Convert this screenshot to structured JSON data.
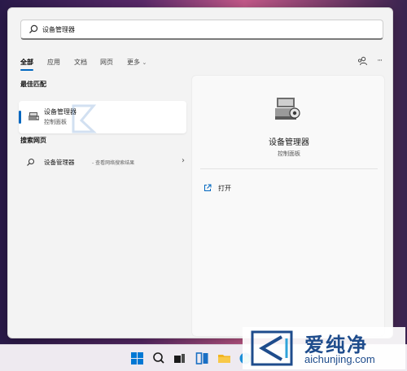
{
  "search": {
    "value": "设备管理器"
  },
  "filters": {
    "tabs": [
      {
        "label": "全部",
        "active": true
      },
      {
        "label": "应用"
      },
      {
        "label": "文档"
      },
      {
        "label": "网页"
      },
      {
        "label": "更多"
      }
    ],
    "more_chevron": "⌄",
    "ellipsis": "···",
    "share_icon": "people-icon"
  },
  "best_match": {
    "header": "最佳匹配",
    "item": {
      "title": "设备管理器",
      "subtitle": "控制面板",
      "icon": "device-manager-icon"
    }
  },
  "web_search": {
    "header": "搜索网页",
    "item": {
      "title": "设备管理器",
      "subtitle": "- 查看网络搜索结果",
      "chevron": "›"
    }
  },
  "detail": {
    "title": "设备管理器",
    "subtitle": "控制面板",
    "actions": [
      {
        "label": "打开",
        "icon": "open-external-icon"
      }
    ]
  },
  "taskbar": {
    "icons": [
      "windows-start-icon",
      "search-icon",
      "task-view-icon",
      "widgets-icon",
      "file-explorer-icon",
      "edge-icon"
    ]
  },
  "watermark": {
    "brand": "爱纯净",
    "url": "aichunjing.com"
  },
  "colors": {
    "accent": "#0067c0",
    "brand": "#1e4c8c",
    "panel_bg": "#f3f3f3"
  }
}
